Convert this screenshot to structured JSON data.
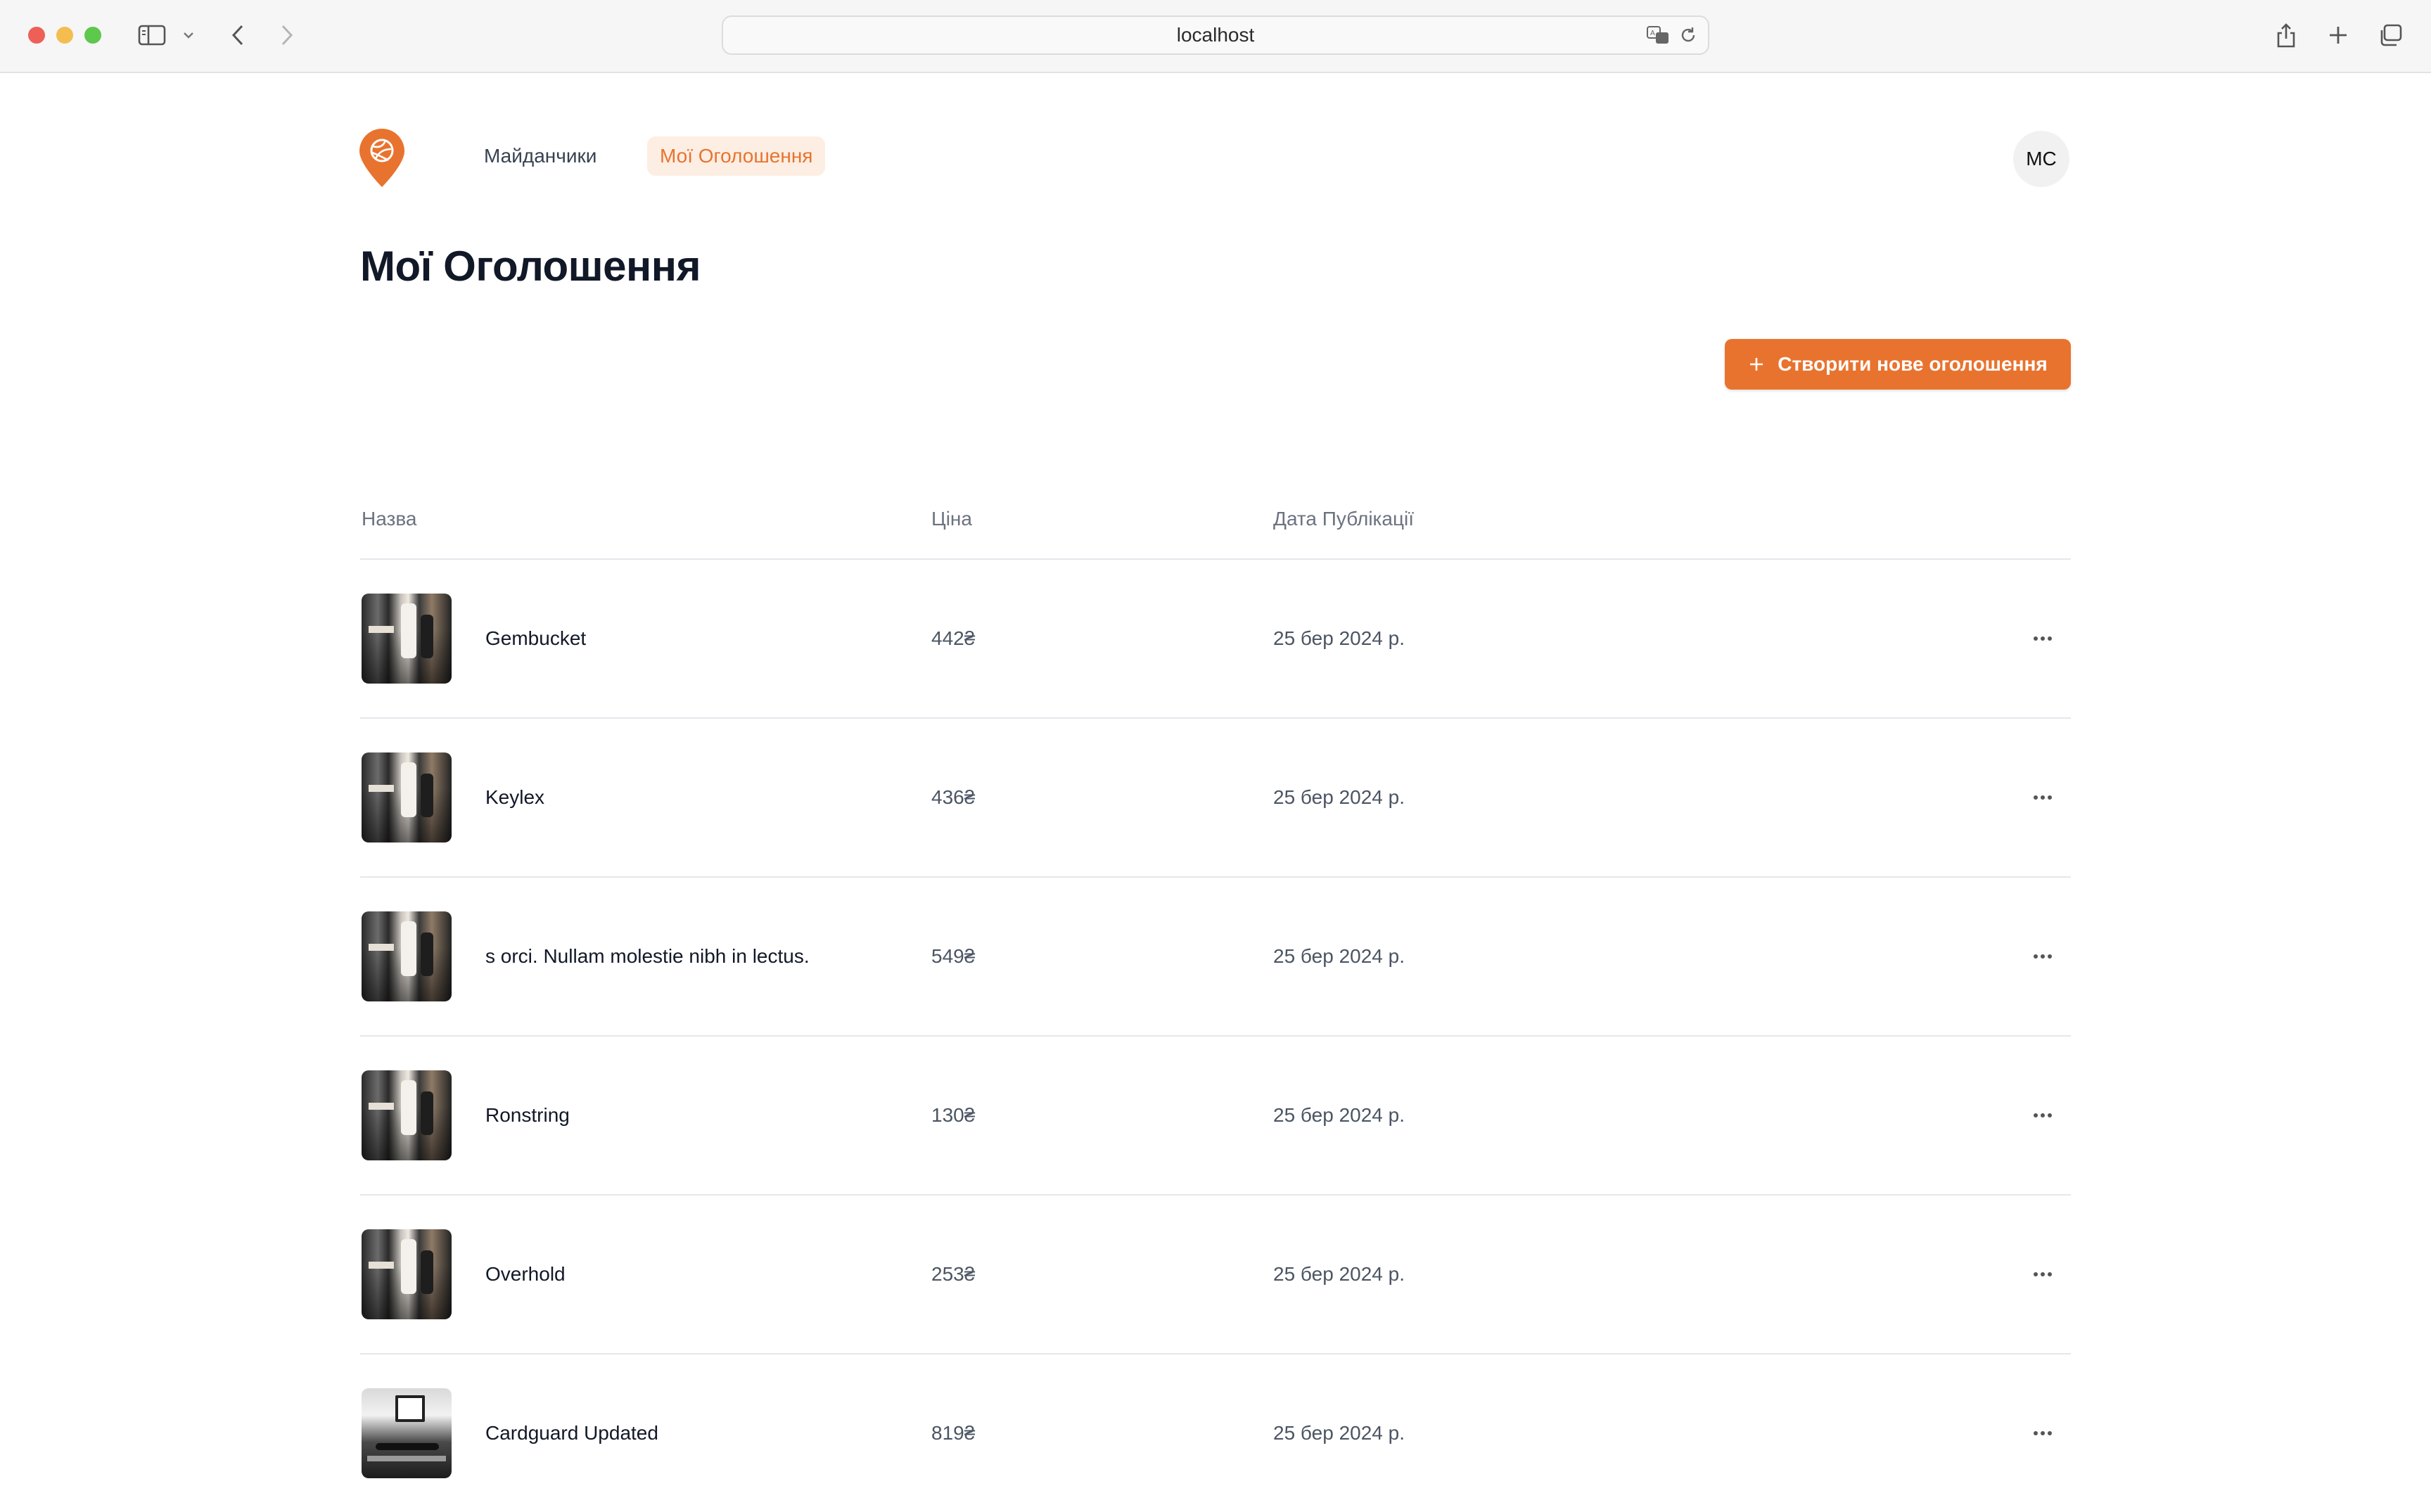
{
  "browser": {
    "url": "localhost"
  },
  "nav": {
    "items": [
      {
        "label": "Майданчики"
      },
      {
        "label": "Мої Оголошення",
        "active": true
      }
    ],
    "user_initials": "MC"
  },
  "main": {
    "title": "Мої Оголошення",
    "create_button_label": "Створити нове оголошення",
    "columns": {
      "name": "Назва",
      "price": "Ціна",
      "date": "Дата Публікації"
    },
    "rows": [
      {
        "name": "Gembucket",
        "price": "442₴",
        "date": "25 бер 2024 р.",
        "thumbnail": "basketball-photo-color"
      },
      {
        "name": "Keylex",
        "price": "436₴",
        "date": "25 бер 2024 р.",
        "thumbnail": "basketball-photo-color"
      },
      {
        "name": "s orci. Nullam molestie nibh in lectus.",
        "price": "549₴",
        "date": "25 бер 2024 р.",
        "thumbnail": "basketball-photo-color"
      },
      {
        "name": "Ronstring",
        "price": "130₴",
        "date": "25 бер 2024 р.",
        "thumbnail": "basketball-photo-color"
      },
      {
        "name": "Overhold",
        "price": "253₴",
        "date": "25 бер 2024 р.",
        "thumbnail": "basketball-photo-color"
      },
      {
        "name": "Cardguard Updated",
        "price": "819₴",
        "date": "25 бер 2024 р.",
        "thumbnail": "basketball-court-photo-bw"
      }
    ]
  },
  "colors": {
    "accent": "#e8732f",
    "accent_soft": "#fdeee3",
    "text": "#111827",
    "muted": "#6b7280",
    "divider": "#e5e7eb"
  }
}
